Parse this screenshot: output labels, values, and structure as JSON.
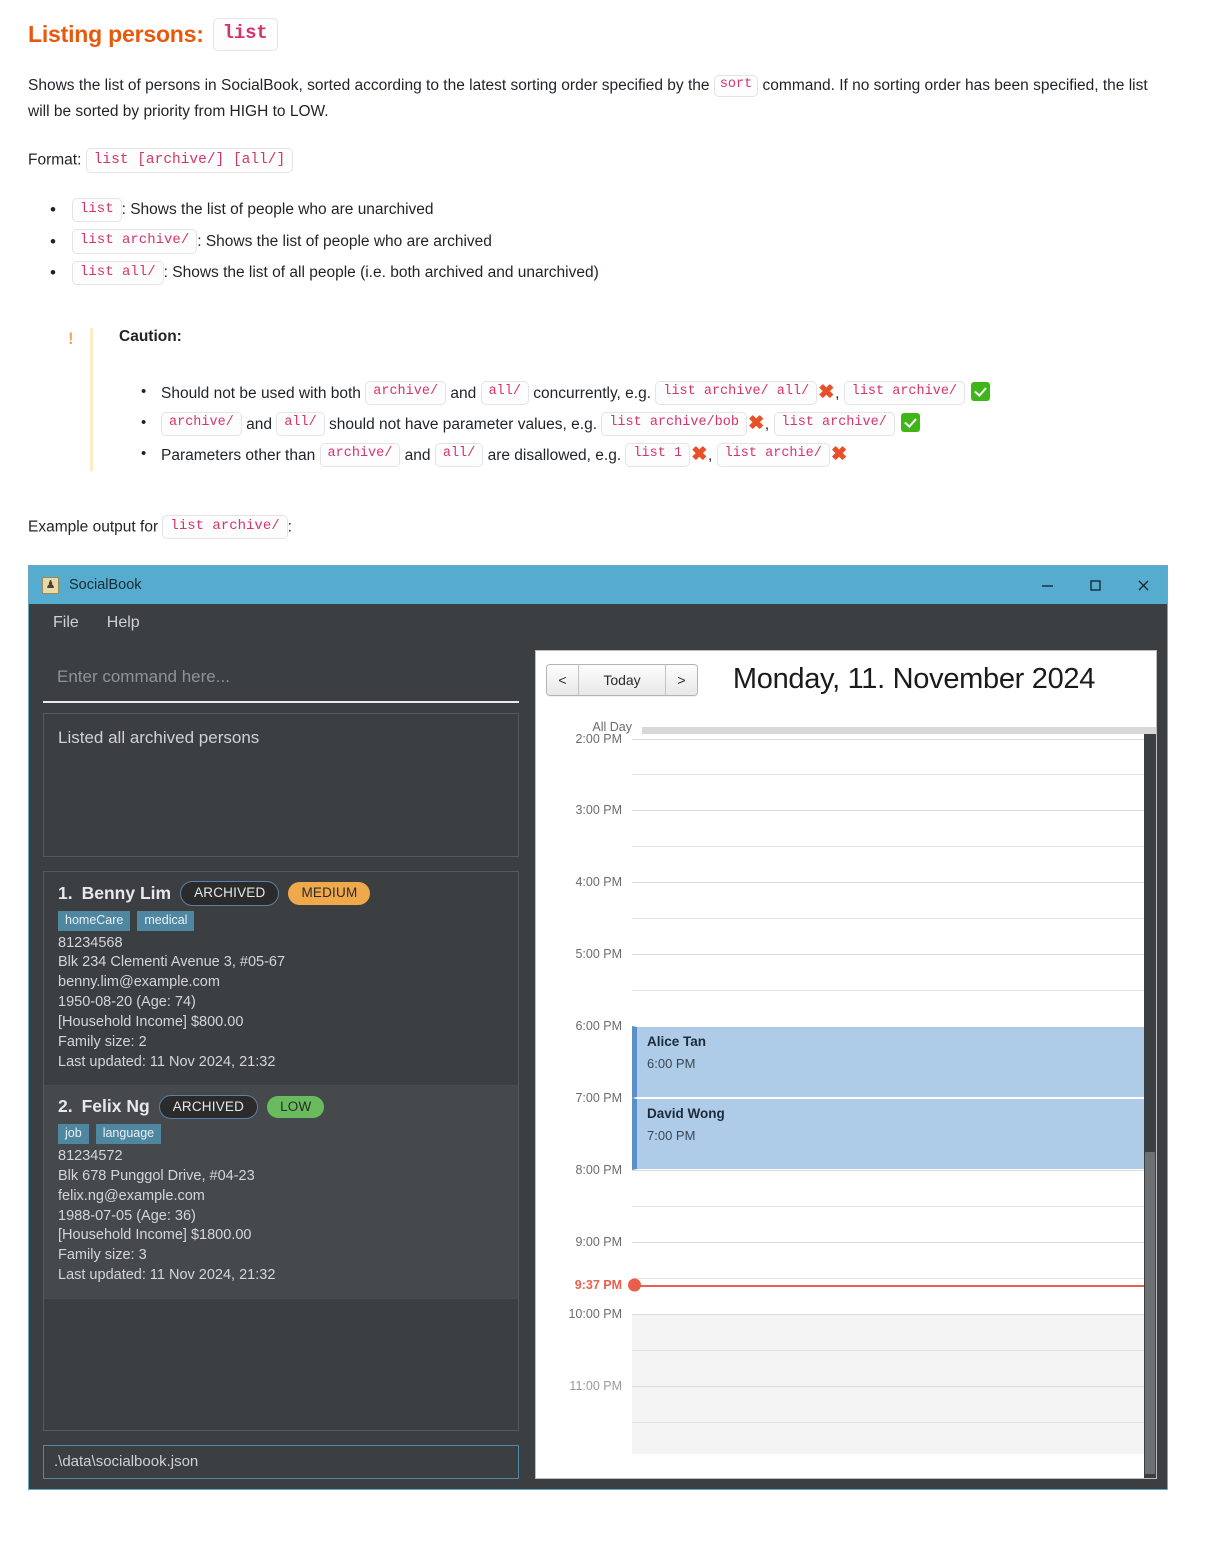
{
  "doc": {
    "title_prefix": "Listing persons:",
    "title_code": "list",
    "intro_part1": "Shows the list of persons in SocialBook, sorted according to the latest sorting order specified by the",
    "intro_code": "sort",
    "intro_part2": "command. If no sorting order has been specified, the list will be sorted by priority from HIGH to LOW.",
    "format_label": "Format:",
    "format_code": "list [archive/] [all/]",
    "bullets": [
      {
        "code": "list",
        "text": ": Shows the list of people who are unarchived"
      },
      {
        "code": "list archive/",
        "text": ": Shows the list of people who are archived"
      },
      {
        "code": "list all/",
        "text": ": Shows the list of all people (i.e. both archived and unarchived)"
      }
    ],
    "caution": {
      "bang": "!",
      "title": "Caution:",
      "items": [
        {
          "pre": "Should not be used with both",
          "code1": "archive/",
          "mid": "and",
          "code2": "all/",
          "post": "concurrently, e.g.",
          "ex1": "list archive/ all/",
          "mark1": "x",
          "sep": ",",
          "ex2": "list archive/",
          "mark2": "check"
        },
        {
          "pre": "",
          "code1": "archive/",
          "mid": "and",
          "code2": "all/",
          "post": "should not have parameter values, e.g.",
          "ex1": "list archive/bob",
          "mark1": "x",
          "sep": ",",
          "ex2": "list archive/",
          "mark2": "check"
        },
        {
          "pre": "Parameters other than",
          "code1": "archive/",
          "mid": "and",
          "code2": "all/",
          "post": "are disallowed, e.g.",
          "ex1": "list 1",
          "mark1": "x",
          "sep": ",",
          "ex2": "list archie/",
          "mark2": "x"
        }
      ]
    },
    "example_label": "Example output for",
    "example_code": "list archive/",
    "example_colon": ":"
  },
  "app": {
    "title": "SocialBook",
    "icon": "person-icon",
    "window_buttons": {
      "minimize": "minimize-icon",
      "maximize": "maximize-icon",
      "close": "close-icon"
    },
    "menu": [
      "File",
      "Help"
    ],
    "command_placeholder": "Enter command here...",
    "result_text": "Listed all archived persons",
    "status_path": ".\\data\\socialbook.json",
    "persons": [
      {
        "index": "1.",
        "name": "Benny Lim",
        "archived_label": "ARCHIVED",
        "priority_label": "MEDIUM",
        "priority_color": "#efa94a",
        "tags": [
          "homeCare",
          "medical"
        ],
        "phone": "81234568",
        "address": "Blk 234 Clementi Avenue 3, #05-67",
        "email": "benny.lim@example.com",
        "birthday": "1950-08-20 (Age: 74)",
        "income": "[Household Income] $800.00",
        "family": "Family size: 2",
        "updated": "Last updated: 11 Nov 2024, 21:32"
      },
      {
        "index": "2.",
        "name": "Felix Ng",
        "archived_label": "ARCHIVED",
        "priority_label": "LOW",
        "priority_color": "#69bb5e",
        "tags": [
          "job",
          "language"
        ],
        "phone": "81234572",
        "address": "Blk 678 Punggol Drive, #04-23",
        "email": "felix.ng@example.com",
        "birthday": "1988-07-05 (Age: 36)",
        "income": "[Household Income] $1800.00",
        "family": "Family size: 3",
        "updated": "Last updated: 11 Nov 2024, 21:32"
      }
    ],
    "calendar": {
      "prev_label": "<",
      "today_label": "Today",
      "next_label": ">",
      "date_title": "Monday, 11. November 2024",
      "allday_label": "All Day",
      "hours": [
        "2:00 PM",
        "3:00 PM",
        "4:00 PM",
        "5:00 PM",
        "6:00 PM",
        "7:00 PM",
        "8:00 PM",
        "9:00 PM",
        "10:00 PM",
        "11:00 PM"
      ],
      "current_time": "9:37 PM",
      "events": [
        {
          "title": "Alice Tan",
          "time": "6:00 PM"
        },
        {
          "title": "David Wong",
          "time": "7:00 PM"
        }
      ]
    }
  }
}
